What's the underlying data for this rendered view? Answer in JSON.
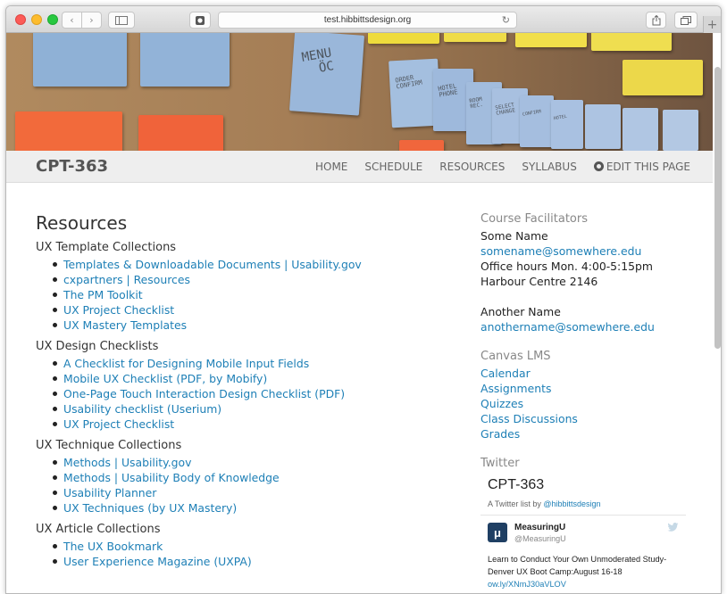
{
  "browser": {
    "url": "test.hibbittsdesign.org",
    "back_glyph": "‹",
    "forward_glyph": "›",
    "reload_glyph": "↻",
    "newtab_glyph": "+",
    "icons": [
      "back-icon",
      "forward-icon",
      "sidebar-icon",
      "extension-icon",
      "reload-icon",
      "share-icon",
      "tabs-icon",
      "new-tab-icon"
    ]
  },
  "hero": {
    "notes": [
      "MENU\n  ÖC",
      "ORDER\nCONFIRM",
      "HOTEL\nPHONE",
      "ROOM\nREC.",
      "SELECT\nCHANGE",
      "CONFIRM",
      "HOTEL"
    ]
  },
  "site": {
    "brand": "CPT-363",
    "nav": [
      "HOME",
      "SCHEDULE",
      "RESOURCES",
      "SYLLABUS"
    ],
    "edit_label": "EDIT THIS PAGE"
  },
  "main": {
    "title": "Resources",
    "sections": [
      {
        "title": "UX Template Collections",
        "links": [
          "Templates & Downloadable Documents | Usability.gov",
          "cxpartners | Resources",
          "The PM Toolkit",
          "UX Project Checklist",
          "UX Mastery Templates"
        ]
      },
      {
        "title": "UX Design Checklists",
        "links": [
          "A Checklist for Designing Mobile Input Fields",
          "Mobile UX Checklist (PDF, by Mobify)",
          "One-Page Touch Interaction Design Checklist (PDF)",
          "Usability checklist (Userium)",
          "UX Project Checklist"
        ]
      },
      {
        "title": "UX Technique Collections",
        "links": [
          "Methods | Usability.gov",
          "Methods | Usability Body of Knowledge",
          "Usability Planner",
          "UX Techniques (by UX Mastery)"
        ]
      },
      {
        "title": "UX Article Collections",
        "links": [
          "The UX Bookmark",
          "User Experience Magazine (UXPA)"
        ]
      }
    ]
  },
  "sidebar": {
    "facilitators_heading": "Course Facilitators",
    "facilitator1": {
      "name": "Some Name",
      "email": "somename@somewhere.edu",
      "hours": "Office hours Mon. 4:00-5:15pm",
      "location": "Harbour Centre 2146"
    },
    "facilitator2": {
      "name": "Another Name",
      "email": "anothername@somewhere.edu"
    },
    "canvas_heading": "Canvas LMS",
    "canvas_links": [
      "Calendar",
      "Assignments",
      "Quizzes",
      "Class Discussions",
      "Grades"
    ],
    "twitter_heading": "Twitter",
    "twitter": {
      "list_title": "CPT-363",
      "list_by": "A Twitter list by",
      "list_owner": "@hibbittsdesign",
      "tweet": {
        "avatar_letter": "μ",
        "name": "MeasuringU",
        "handle": "@MeasuringU",
        "text": "Learn to Conduct Your Own Unmoderated Study-Denver UX Boot Camp:August 16-18",
        "link": "ow.ly/XNmJ30aVLOV"
      }
    }
  },
  "colors": {
    "link": "#1d7fb6",
    "header_bg": "#eeeeee",
    "brand_text": "#555555"
  }
}
